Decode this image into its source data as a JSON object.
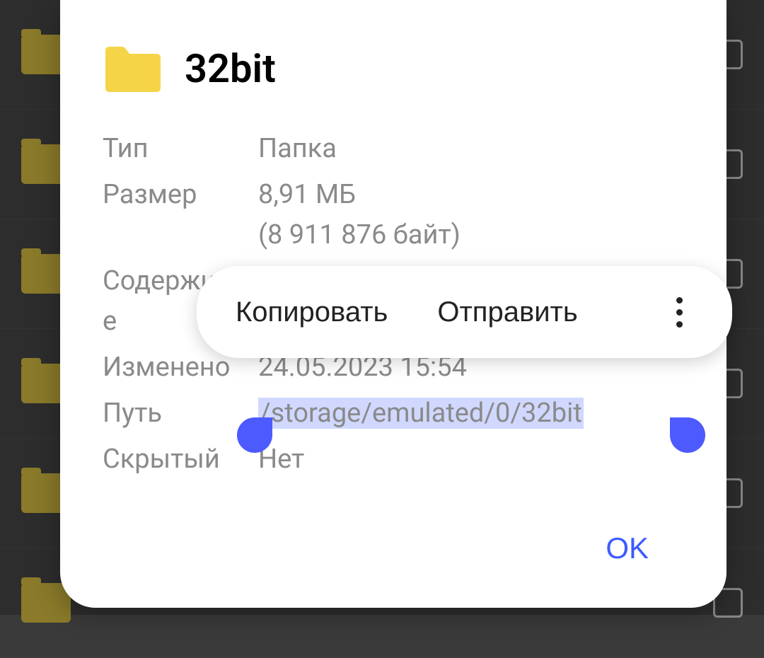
{
  "header": {
    "title": "32bit"
  },
  "labels": {
    "type": "Тип",
    "size": "Размер",
    "contents": "Содержимое",
    "modified": "Изменено",
    "path": "Путь",
    "hidden": "Скрытый"
  },
  "values": {
    "type": "Папка",
    "size": "8,91 МБ",
    "size_bytes": "(8 911 876 байт)",
    "modified": "24.05.2023 15:54",
    "path": "/storage/emulated/0/32bit",
    "hidden": "Нет"
  },
  "context_menu": {
    "copy": "Копировать",
    "send": "Отправить"
  },
  "buttons": {
    "ok": "OK"
  },
  "colors": {
    "folder": "#f5d547",
    "accent": "#3b5bff",
    "selection": "#d0d8ff"
  }
}
